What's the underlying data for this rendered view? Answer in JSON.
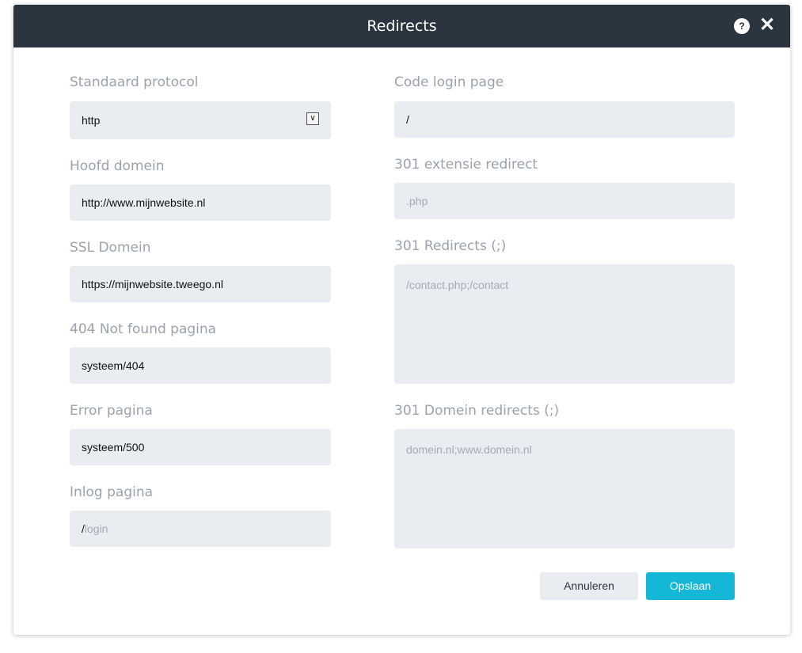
{
  "dialog": {
    "title": "Redirects",
    "help_icon": "?",
    "close_icon": "✕"
  },
  "left": [
    {
      "label": "Standaard protocol",
      "value": "http",
      "type": "select"
    },
    {
      "label": "Hoofd domein",
      "value": "http://www.mijnwebsite.nl"
    },
    {
      "label": "SSL Domein",
      "value": "https://mijnwebsite.tweego.nl"
    },
    {
      "label": "404 Not found pagina",
      "value": "systeem/404"
    },
    {
      "label": "Error pagina",
      "value": "systeem/500"
    },
    {
      "label": "Inlog pagina",
      "prefix": "/",
      "placeholder": "login"
    }
  ],
  "right": [
    {
      "label": "Code login page",
      "value": "/"
    },
    {
      "label": "301 extensie redirect",
      "placeholder": ".php"
    },
    {
      "label": "301 Redirects (;)",
      "placeholder": "/contact.php;/contact"
    },
    {
      "label": "301 Domein redirects (;)",
      "placeholder": "domein.nl;www.domein.nl"
    }
  ],
  "buttons": {
    "cancel": "Annuleren",
    "save": "Opslaan"
  },
  "colors": {
    "header": "#2b3540",
    "primary": "#14b8d6",
    "field": "#e9ecf0"
  }
}
